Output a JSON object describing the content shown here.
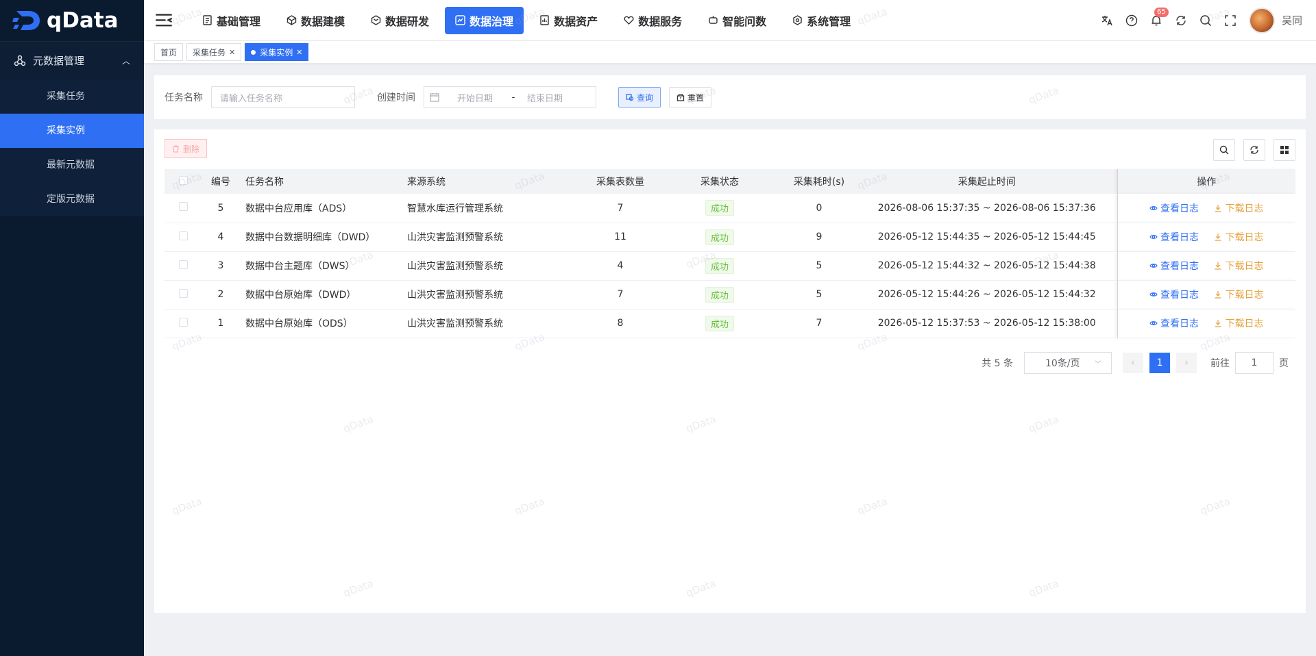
{
  "app": {
    "logo_text": "qData"
  },
  "sidebar": {
    "group_label": "元数据管理",
    "items": [
      {
        "label": "采集任务"
      },
      {
        "label": "采集实例"
      },
      {
        "label": "最新元数据"
      },
      {
        "label": "定版元数据"
      }
    ]
  },
  "nav": {
    "items": [
      {
        "label": "基础管理"
      },
      {
        "label": "数据建模"
      },
      {
        "label": "数据研发"
      },
      {
        "label": "数据治理"
      },
      {
        "label": "数据资产"
      },
      {
        "label": "数据服务"
      },
      {
        "label": "智能问数"
      },
      {
        "label": "系统管理"
      }
    ],
    "active_index": 3
  },
  "header_tools": {
    "notification_count": "65",
    "username": "吴同"
  },
  "tabs": {
    "items": [
      {
        "label": "首页"
      },
      {
        "label": "采集任务"
      },
      {
        "label": "采集实例"
      }
    ]
  },
  "search": {
    "task_name_label": "任务名称",
    "task_name_placeholder": "请输入任务名称",
    "created_label": "创建时间",
    "start_placeholder": "开始日期",
    "range_separator": "-",
    "end_placeholder": "结束日期",
    "query_label": "查询",
    "reset_label": "重置"
  },
  "toolbar": {
    "delete_label": "删除"
  },
  "table": {
    "headers": {
      "no": "编号",
      "name": "任务名称",
      "source": "来源系统",
      "count": "采集表数量",
      "status": "采集状态",
      "duration": "采集耗时(s)",
      "time": "采集起止时间",
      "op": "操作"
    },
    "view_log_label": "查看日志",
    "download_log_label": "下载日志",
    "rows": [
      {
        "no": "5",
        "name": "数据中台应用库（ADS）",
        "source": "智慧水库运行管理系统",
        "count": "7",
        "status": "成功",
        "duration": "0",
        "time": "2026-08-06 15:37:35 ~ 2026-08-06 15:37:36"
      },
      {
        "no": "4",
        "name": "数据中台数据明细库（DWD）",
        "source": "山洪灾害监测预警系统",
        "count": "11",
        "status": "成功",
        "duration": "9",
        "time": "2026-05-12 15:44:35 ~ 2026-05-12 15:44:45"
      },
      {
        "no": "3",
        "name": "数据中台主题库（DWS）",
        "source": "山洪灾害监测预警系统",
        "count": "4",
        "status": "成功",
        "duration": "5",
        "time": "2026-05-12 15:44:32 ~ 2026-05-12 15:44:38"
      },
      {
        "no": "2",
        "name": "数据中台原始库（DWD）",
        "source": "山洪灾害监测预警系统",
        "count": "7",
        "status": "成功",
        "duration": "5",
        "time": "2026-05-12 15:44:26 ~ 2026-05-12 15:44:32"
      },
      {
        "no": "1",
        "name": "数据中台原始库（ODS）",
        "source": "山洪灾害监测预警系统",
        "count": "8",
        "status": "成功",
        "duration": "7",
        "time": "2026-05-12 15:37:53 ~ 2026-05-12 15:38:00"
      }
    ]
  },
  "pagination": {
    "total_text": "共 5 条",
    "page_size": "10条/页",
    "current_page": "1",
    "goto_label": "前往",
    "goto_value": "1",
    "page_suffix": "页"
  },
  "watermark": "qData",
  "colors": {
    "primary": "#2f6ff4",
    "sidebar_bg": "#0a1a2f",
    "success": "#67c23a",
    "warning": "#e6a23c",
    "danger": "#f56c6c"
  }
}
